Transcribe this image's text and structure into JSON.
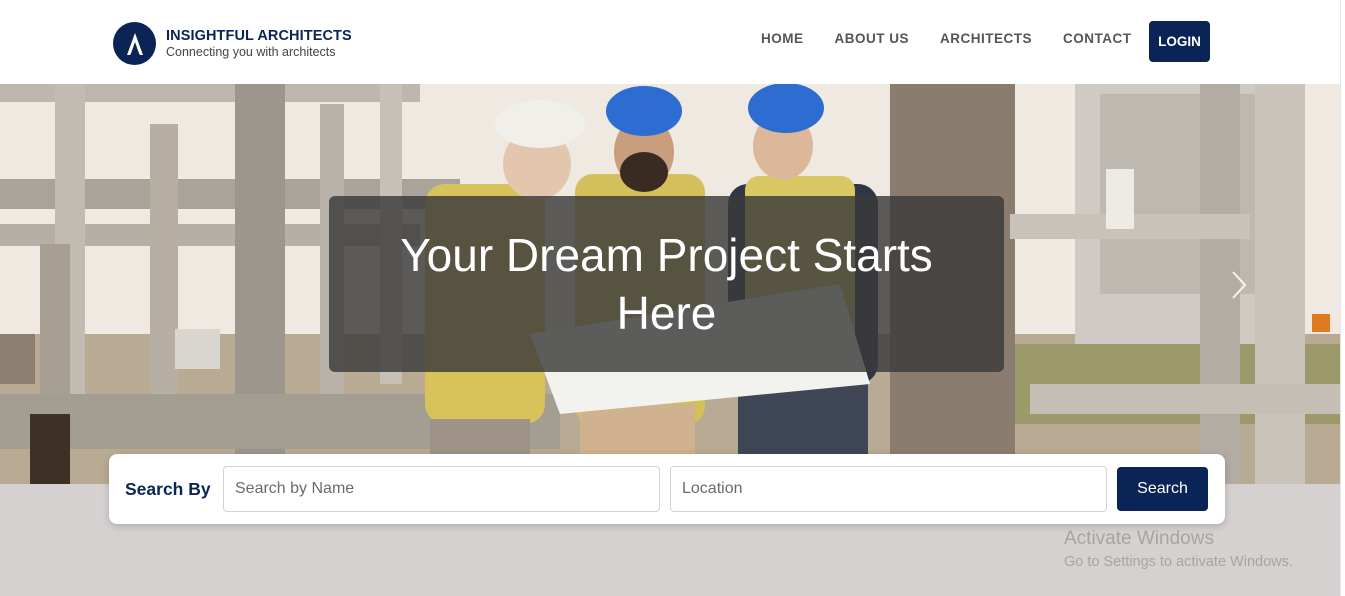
{
  "brand": {
    "name": "INSIGHTFUL ARCHITECTS",
    "tagline": "Connecting you with architects",
    "logo_icon": "letter-a-logo-icon",
    "color": "#0b2456"
  },
  "nav": {
    "items": [
      {
        "label": "HOME"
      },
      {
        "label": "ABOUT US"
      },
      {
        "label": "ARCHITECTS"
      },
      {
        "label": "CONTACT"
      }
    ],
    "login_label": "LOGIN"
  },
  "hero": {
    "headline": "Your Dream Project Starts Here",
    "next_icon": "chevron-right-icon"
  },
  "search": {
    "label": "Search By",
    "name_placeholder": "Search by Name",
    "location_placeholder": "Location",
    "button_label": "Search"
  },
  "watermark": {
    "title": "Activate Windows",
    "subtitle": "Go to Settings to activate Windows."
  }
}
